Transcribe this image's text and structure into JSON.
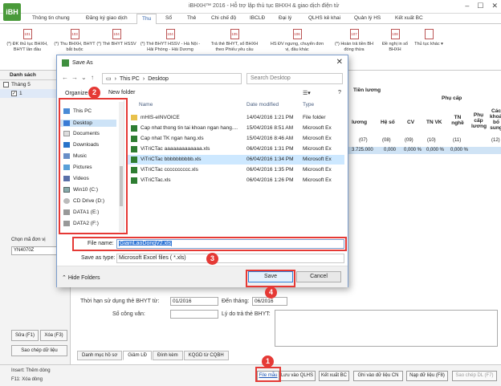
{
  "app": {
    "logo": "iBH",
    "title": "iBHXH™ 2016 - Hỗ trợ lập thủ tục BHXH & giao dịch điện tử",
    "window_buttons": [
      "–",
      "☐",
      "✕"
    ]
  },
  "ribbon": {
    "tabs": [
      "Thông tin chung",
      "Đăng ký giao dịch",
      "Thu",
      "Sổ",
      "Thẻ",
      "Chi chế độ",
      "IBCLĐ",
      "Đại lý",
      "QLHS kê khai",
      "Quản lý HS",
      "Kết xuất BC"
    ],
    "buttons": [
      {
        "code": "101",
        "label": "(*) ĐK thủ tục BHXH, BHYT lần đầu"
      },
      {
        "code": "103",
        "label": "(*) Thu BHXH, BHYT bắt buộc"
      },
      {
        "code": "104",
        "label": "(*) Thẻ BHYT HSSV"
      },
      {
        "code": "104",
        "label": "(*) Thẻ BHYT HSSV - Hà Nội - Hải Phòng - Hải Dương"
      },
      {
        "code": "105",
        "label": "Trả thẻ BHYT, sổ BHXH theo Phiếu yêu cầu"
      },
      {
        "code": "106",
        "label": "HS ĐV ngưng, chuyển đơn vị, đầu khác"
      },
      {
        "code": "107",
        "label": "(*) Hoàn trả tiền BH đóng thừa"
      },
      {
        "code": "108",
        "label": "Đề nghị in sổ BHXH"
      },
      {
        "code": "",
        "label": "Thủ tục khác ▾"
      }
    ]
  },
  "left_panel": {
    "header": "Danh sách",
    "tree": [
      {
        "label": "Tháng 5"
      },
      {
        "label": "1"
      }
    ],
    "unit_label": "Chọn mã đơn vị",
    "unit_value": "YN4070Z",
    "edit_button": "Sửa (F1)",
    "delete_button": "Xóa (F3)",
    "copy_button": "Sao chép dữ liệu"
  },
  "grid": {
    "headers": {
      "tien_luong": "Tiền lương",
      "phu_cap": "Phụ cấp",
      "luong": "lương",
      "he_so": "Hệ số",
      "cv": "CV",
      "tnvk": "TN VK",
      "tn_nghe": "TN nghề",
      "phu_cap_luong": "Phụ cấp lương",
      "cac_khoan": "Các khoản bổ sung"
    },
    "index_row": [
      "(07)",
      "(08)",
      "(09)",
      "(10)",
      "(11)",
      "(12)"
    ],
    "data_row": [
      "3.725.000",
      "0,000",
      "0,000 %",
      "0,000 %",
      "0,000 %"
    ]
  },
  "form": {
    "valid_from_label": "Thời hạn sử dụng thẻ BHYT từ:",
    "valid_from_value": "01/2016",
    "valid_to_label": "Đến tháng:",
    "valid_to_value": "06/2016",
    "so_cong_van_label": "Số công văn:",
    "ly_do_label": "Lý do trả thẻ BHYT:"
  },
  "subtabs": [
    "Danh mục hồ sơ",
    "Giảm LĐ",
    "Đính kèm",
    "KQGD từ CQBH"
  ],
  "statusbar": {
    "hint_insert": "Insert: Thêm dòng",
    "hint_delete": "F11: Xóa dòng",
    "buttons": [
      "File mẫu",
      "Lưu vào QLHS",
      "Kết xuất BC",
      "Ghi vào dữ liệu CN",
      "Nạp dữ liệu (F8)",
      "Sao chép DL (F7)"
    ]
  },
  "dialog": {
    "title": "Save As",
    "close": "✕",
    "address": [
      "This PC",
      "Desktop"
    ],
    "search_placeholder": "Search Desktop",
    "organize": "Organize ▾",
    "new_folder": "New folder",
    "nav_items": [
      "This PC",
      "Desktop",
      "Documents",
      "Downloads",
      "Music",
      "Pictures",
      "Videos",
      "Win10 (C:)",
      "CD Drive (D:)",
      "DATA1 (E:)",
      "DATA2 (F:)"
    ],
    "columns": {
      "name": "Name",
      "date": "Date modified",
      "type": "Type"
    },
    "files": [
      {
        "name": "mHIS-eINVOICE",
        "date": "14/04/2016 1:21 PM",
        "type": "File folder",
        "kind": "folder"
      },
      {
        "name": "Cap nhat thong tin tai khoan ngan hang....",
        "date": "15/04/2016 8:51 AM",
        "type": "Microsoft Ex",
        "kind": "xls"
      },
      {
        "name": "Cap nhat TK ngan hang.xls",
        "date": "15/04/2016 8:46 AM",
        "type": "Microsoft Ex",
        "kind": "xls"
      },
      {
        "name": "ViTriCTac aaaaaaaaaaaaa.xls",
        "date": "06/04/2016 1:31 PM",
        "type": "Microsoft Ex",
        "kind": "xls"
      },
      {
        "name": "ViTriCTac bbbbbbbbbb.xls",
        "date": "06/04/2016 1:34 PM",
        "type": "Microsoft Ex",
        "kind": "xls"
      },
      {
        "name": "ViTriCTac cccccccccc.xls",
        "date": "06/04/2016 1:35 PM",
        "type": "Microsoft Ex",
        "kind": "xls"
      },
      {
        "name": "ViTriCTac.xls",
        "date": "06/04/2016 1:26 PM",
        "type": "Microsoft Ex",
        "kind": "xls"
      }
    ],
    "file_name_label": "File name:",
    "file_name_value": "GiamLaoDongV2.xls",
    "save_type_label": "Save as type:",
    "save_type_value": "Microsoft Excel files  ( *.xls)",
    "hide_folders": "Hide Folders",
    "save_button": "Save",
    "cancel_button": "Cancel"
  },
  "annotations": [
    "1",
    "2",
    "3",
    "4"
  ],
  "colors": {
    "accent": "#2a5ea8",
    "annotation": "#e53935",
    "selection": "#cde8ff"
  }
}
